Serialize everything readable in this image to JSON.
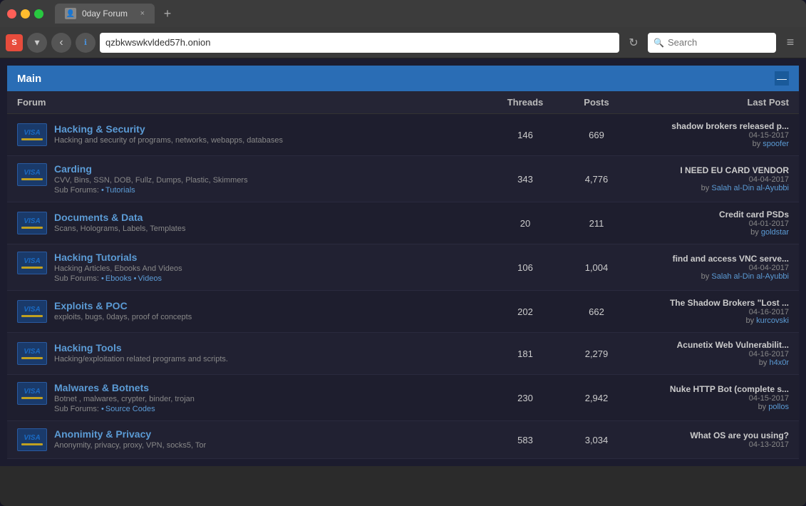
{
  "browser": {
    "tab_title": "0day Forum",
    "url": "qzbkwswkvlded57h.onion",
    "search_placeholder": "Search",
    "new_tab_symbol": "+",
    "close_tab": "×"
  },
  "header": {
    "title": "Main",
    "minimize": "—"
  },
  "columns": {
    "forum": "Forum",
    "threads": "Threads",
    "posts": "Posts",
    "last_post": "Last Post"
  },
  "forums": [
    {
      "icon": "VISA",
      "title": "Hacking & Security",
      "desc": "Hacking and security of programs, networks, webapps, databases",
      "subforums": [],
      "threads": "146",
      "posts": "669",
      "last_post_title": "shadow brokers released p...",
      "last_post_date": "04-15-2017",
      "last_post_by": "spoofer"
    },
    {
      "icon": "VISA",
      "title": "Carding",
      "desc": "CVV, Bins, SSN, DOB, Fullz, Dumps, Plastic, Skimmers",
      "subforums": [
        "Tutorials"
      ],
      "threads": "343",
      "posts": "4,776",
      "last_post_title": "I NEED EU CARD VENDOR",
      "last_post_date": "04-04-2017",
      "last_post_by": "Salah al-Din al-Ayubbi"
    },
    {
      "icon": "VISA",
      "title": "Documents & Data",
      "desc": "Scans, Holograms, Labels, Templates",
      "subforums": [],
      "threads": "20",
      "posts": "211",
      "last_post_title": "Credit card PSDs",
      "last_post_date": "04-01-2017",
      "last_post_by": "goldstar"
    },
    {
      "icon": "VISA",
      "title": "Hacking Tutorials",
      "desc": "Hacking Articles, Ebooks And Videos",
      "subforums": [
        "Ebooks",
        "Videos"
      ],
      "threads": "106",
      "posts": "1,004",
      "last_post_title": "find and access VNC serve...",
      "last_post_date": "04-04-2017",
      "last_post_by": "Salah al-Din al-Ayubbi"
    },
    {
      "icon": "VISA",
      "title": "Exploits & POC",
      "desc": "exploits, bugs, 0days, proof of concepts",
      "subforums": [],
      "threads": "202",
      "posts": "662",
      "last_post_title": "The Shadow Brokers \"Lost ...",
      "last_post_date": "04-16-2017",
      "last_post_by": "kurcovski"
    },
    {
      "icon": "VISA",
      "title": "Hacking Tools",
      "desc": "Hacking/exploitation related programs and scripts.",
      "subforums": [],
      "threads": "181",
      "posts": "2,279",
      "last_post_title": "Acunetix Web Vulnerabilit...",
      "last_post_date": "04-16-2017",
      "last_post_by": "h4x0r"
    },
    {
      "icon": "VISA",
      "title": "Malwares & Botnets",
      "desc": "Botnet , malwares, crypter, binder, trojan",
      "subforums": [
        "Source Codes"
      ],
      "threads": "230",
      "posts": "2,942",
      "last_post_title": "Nuke HTTP Bot (complete s...",
      "last_post_date": "04-15-2017",
      "last_post_by": "pollos"
    },
    {
      "icon": "VISA",
      "title": "Anonimity & Privacy",
      "desc": "Anonymity, privacy, proxy, VPN, socks5, Tor",
      "subforums": [],
      "threads": "583",
      "posts": "3,034",
      "last_post_title": "What OS are you using?",
      "last_post_date": "04-13-2017",
      "last_post_by": ""
    }
  ]
}
